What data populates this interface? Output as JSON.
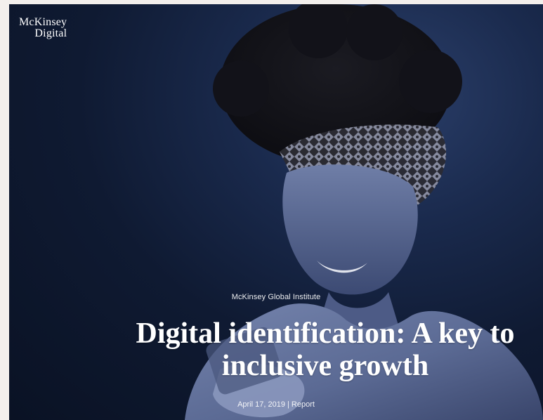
{
  "brand": {
    "logo_line1": "McKinsey",
    "logo_line2": "Digital"
  },
  "hero": {
    "kicker": "McKinsey Global Institute",
    "title_line1": "Digital identification: A key to",
    "title_line2": "inclusive growth",
    "date_type": "April 17, 2019 | Report"
  },
  "colors": {
    "background": "#0f1a32",
    "text": "#ffffff",
    "page": "#f3efec"
  }
}
